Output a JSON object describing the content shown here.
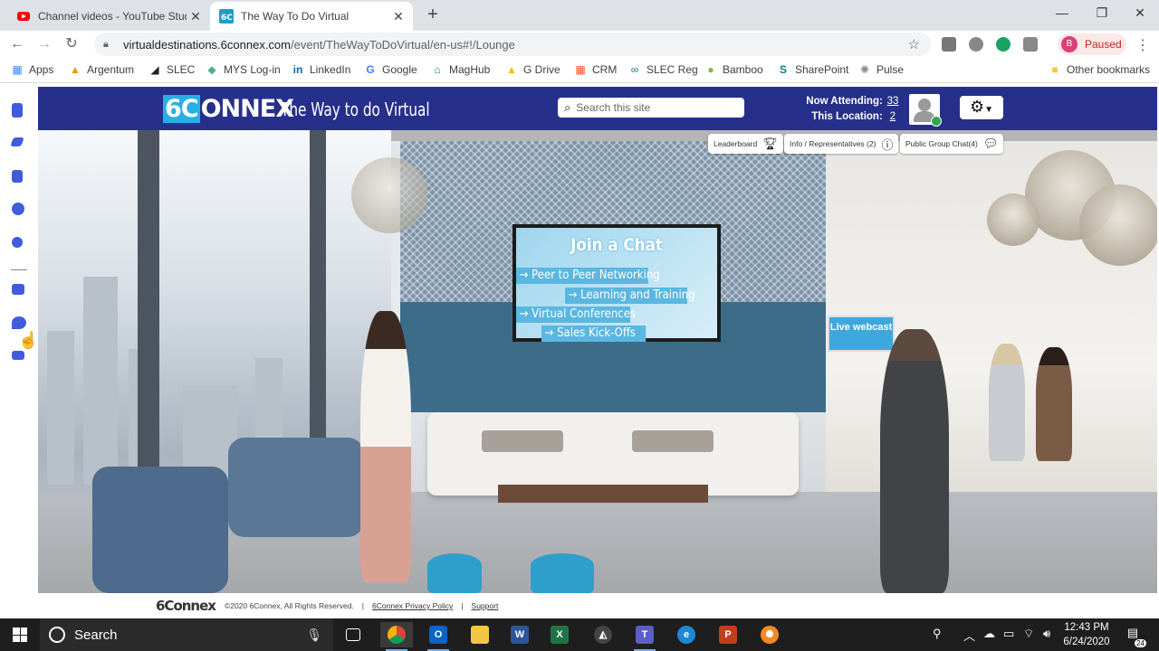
{
  "browser": {
    "tabs": [
      {
        "title": "Channel videos - YouTube Studio",
        "icon": "youtube-icon",
        "active": false
      },
      {
        "title": "The Way To Do Virtual",
        "icon": "6connex-icon",
        "active": true
      }
    ],
    "url_host": "virtualdestinations.6connex.com",
    "url_path": "/event/TheWayToDoVirtual/en-us#!/Lounge",
    "profile_initial": "B",
    "profile_status": "Paused",
    "bookmarks": [
      {
        "label": "Apps",
        "icon": "apps-grid-icon"
      },
      {
        "label": "Argentum",
        "icon": "argentum-icon"
      },
      {
        "label": "SLEC",
        "icon": "slec-icon"
      },
      {
        "label": "MYS Log-in",
        "icon": "mys-icon"
      },
      {
        "label": "LinkedIn",
        "icon": "linkedin-icon"
      },
      {
        "label": "Google",
        "icon": "google-icon"
      },
      {
        "label": "MagHub",
        "icon": "maghub-icon"
      },
      {
        "label": "G Drive",
        "icon": "gdrive-icon"
      },
      {
        "label": "CRM",
        "icon": "crm-icon"
      },
      {
        "label": "SLEC Reg",
        "icon": "slec-reg-icon"
      },
      {
        "label": "Bamboo",
        "icon": "bamboo-icon"
      },
      {
        "label": "SharePoint",
        "icon": "sharepoint-icon"
      },
      {
        "label": "Pulse",
        "icon": "pulse-icon"
      }
    ],
    "other_bookmarks": "Other bookmarks"
  },
  "site": {
    "logo": "6CONNEX",
    "tagline": "The Way to do Virtual",
    "search_placeholder": "Search this site",
    "now_attending_label": "Now Attending:",
    "now_attending": "33",
    "this_location_label": "This Location:",
    "this_location": "2",
    "pills": {
      "leaderboard": "Leaderboard",
      "info": "Info / Representatives (2)",
      "chat": "Public Group Chat(4)"
    },
    "screen": {
      "title": "Join a Chat",
      "items": [
        "→ Peer to Peer Networking",
        "→ Learning and Training",
        "→ Virtual Conferences",
        "→ Sales Kick-Offs"
      ]
    },
    "live_webcast": "Live webcast",
    "footer": {
      "logo": "6Connex",
      "copyright": "©2020 6Connex, All Rights Reserved.",
      "privacy": "6Connex Privacy Policy",
      "support": "Support"
    }
  },
  "taskbar": {
    "search_label": "Search",
    "time": "12:43 PM",
    "date": "6/24/2020",
    "notifications": "24"
  },
  "colors": {
    "header_bg": "#26308a",
    "accent_blue": "#28b0e6",
    "tab_bar": "#dee1e6"
  }
}
